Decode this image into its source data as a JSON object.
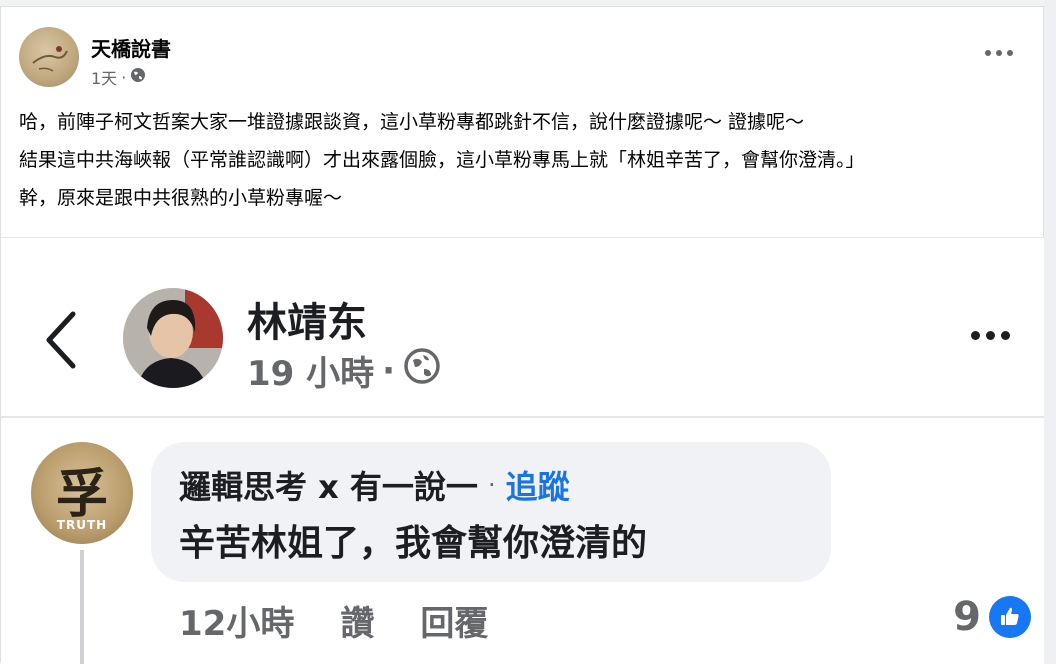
{
  "post": {
    "author": "天橋說書",
    "time": "1天",
    "separator": "·",
    "privacy_icon": "public-globe-icon",
    "more_icon": "more-options-icon",
    "lines": [
      "哈，前陣子柯文哲案大家一堆證據跟談資，這小草粉專都跳針不信，說什麼證據呢～ 證據呢～",
      "結果這中共海峽報（平常誰認識啊）才出來露個臉，這小草粉專馬上就「林姐辛苦了，會幫你澄清。」",
      "幹，原來是跟中共很熟的小草粉專喔～"
    ]
  },
  "embed": {
    "back_icon": "chevron-left-icon",
    "name": "林靖东",
    "time": "19 小時",
    "separator": "·",
    "privacy_icon": "public-globe-icon",
    "more_icon": "more-options-icon",
    "comment": {
      "avatar_glyph": "孚",
      "avatar_label": "TRUTH",
      "author": "邏輯思考 x 有一說一",
      "separator": "·",
      "follow": "追蹤",
      "text": "辛苦林姐了，我會幫你澄清的",
      "time": "12小時",
      "like": "讚",
      "reply": "回覆",
      "reaction_count": "9",
      "reaction_icon": "like-thumb-icon"
    }
  },
  "colors": {
    "link_blue": "#1b74e4",
    "like_blue": "#1877f2",
    "secondary_text": "#65676b"
  }
}
